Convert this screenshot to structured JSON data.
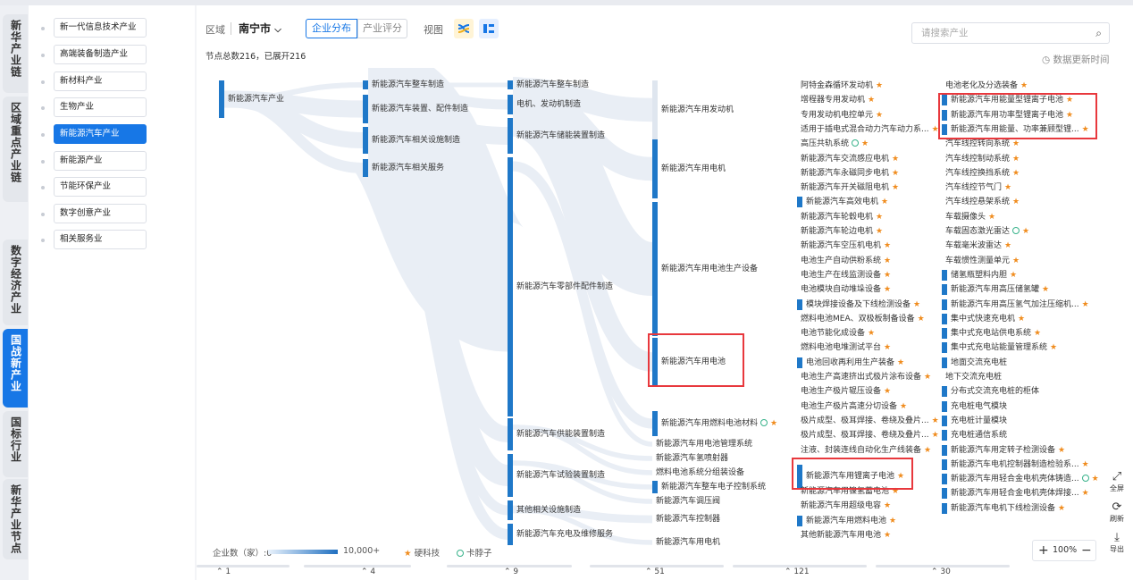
{
  "vtabs": [
    "新华产业链",
    "区域重点产业链",
    "数字经济产业",
    "国战新产业",
    "国标行业",
    "新华产业节点"
  ],
  "categories": [
    "新一代信息技术产业",
    "高端装备制造产业",
    "新材料产业",
    "生物产业",
    "新能源汽车产业",
    "新能源产业",
    "节能环保产业",
    "数字创意产业",
    "相关服务业"
  ],
  "toolbar": {
    "region_label": "区域",
    "region_value": "南宁市",
    "seg1": "企业分布",
    "seg2": "产业评分",
    "view_label": "视图",
    "search_placeholder": "请搜索产业",
    "node_count": "节点总数216，已展开216",
    "update_time": "数据更新时间"
  },
  "col1": [
    "新能源汽车产业"
  ],
  "col2": [
    "新能源汽车整车制造",
    "新能源汽车装置、配件制造",
    "新能源汽车相关设施制造",
    "新能源汽车相关服务"
  ],
  "col3": [
    "新能源汽车整车制造",
    "电机、发动机制造",
    "新能源汽车储能装置制造",
    "新能源汽车零部件配件制造",
    "新能源汽车供能装置制造",
    "新能源汽车试验装置制造",
    "其他相关设施制造",
    "新能源汽车充电及维修服务"
  ],
  "col4": [
    "新能源汽车用发动机",
    "新能源汽车用电机",
    "新能源汽车用电池生产设备",
    "新能源汽车用电池",
    "新能源汽车用燃料电池材料",
    "新能源汽车用电池管理系统",
    "新能源汽车氢喷射器",
    "燃料电池系统分组装设备",
    "新能源汽车整车电子控制系统",
    "新能源汽车调压阀",
    "新能源汽车控制器",
    "新能源汽车用电机"
  ],
  "col5": [
    "阿特金森循环发动机",
    "增程器专用发动机",
    "专用发动机电控单元",
    "适用于插电式混合动力汽车动力系...",
    "高压共轨系统",
    "新能源汽车交流感应电机",
    "新能源汽车永磁同步电机",
    "新能源汽车开关磁阻电机",
    "新能源汽车高效电机",
    "新能源汽车轮毂电机",
    "新能源汽车轮边电机",
    "新能源汽车空压机电机",
    "电池生产自动供粉系统",
    "电池生产在线监测设备",
    "电池模块自动堆垛设备",
    "模块焊接设备及下线检测设备",
    "燃料电池MEA、双极板制备设备",
    "电池节能化成设备",
    "燃料电池电堆测试平台",
    "电池回收再利用生产装备",
    "电池生产高速挤出式极片涂布设备",
    "电池生产极片辊压设备",
    "电池生产极片高速分切设备",
    "极片成型、极耳焊接、卷绕及叠片...",
    "极片成型、极耳焊接、卷绕及叠片...",
    "注液、封装连线自动化生产线装备",
    "新能源汽车用锂离子电池",
    "新能源汽车用镍氢蓄电池",
    "新能源汽车用超级电容",
    "新能源汽车用燃料电池",
    "其他新能源汽车用电池"
  ],
  "col6": [
    "电池老化及分选装备",
    "新能源汽车用能量型锂离子电池",
    "新能源汽车用功率型锂离子电池",
    "新能源汽车用能量、功率兼顾型锂...",
    "汽车线控转向系统",
    "汽车线控制动系统",
    "汽车线控换挡系统",
    "汽车线控节气门",
    "汽车线控悬架系统",
    "车载摄像头",
    "车载固态激光雷达",
    "车载毫米波雷达",
    "车载惯性测量单元",
    "储氢瓶塑料内胆",
    "新能源汽车用高压储氢罐",
    "新能源汽车用高压氢气加注压缩机...",
    "集中式快速充电机",
    "集中式充电站供电系统",
    "集中式充电站能量管理系统",
    "地面交流充电桩",
    "地下交流充电桩",
    "分布式交流充电桩的柜体",
    "充电桩电气模块",
    "充电桩计量模块",
    "充电桩通信系统",
    "新能源汽车用定转子检测设备",
    "新能源汽车电机控制器制造检验系...",
    "新能源汽车用轻合金电机壳体铸造...",
    "新能源汽车用轻合金电机壳体焊接...",
    "新能源汽车电机下线检测设备"
  ],
  "legend": {
    "label": "企业数（家）:0",
    "max": "10,000+",
    "star_label": "硬科技",
    "ring_label": "卡脖子"
  },
  "bottom": [
    "1",
    "4",
    "9",
    "51",
    "121",
    "30"
  ],
  "controls": {
    "fullscreen": "全屏",
    "refresh": "刷新",
    "export": "导出",
    "zoom": "100%",
    "plus": "+",
    "minus": "−"
  },
  "colors": {
    "accent": "#1777e6",
    "bar": "#1f78c8",
    "star": "#f08c1e",
    "ring": "#38b28a",
    "highlight": "#e8383d"
  }
}
